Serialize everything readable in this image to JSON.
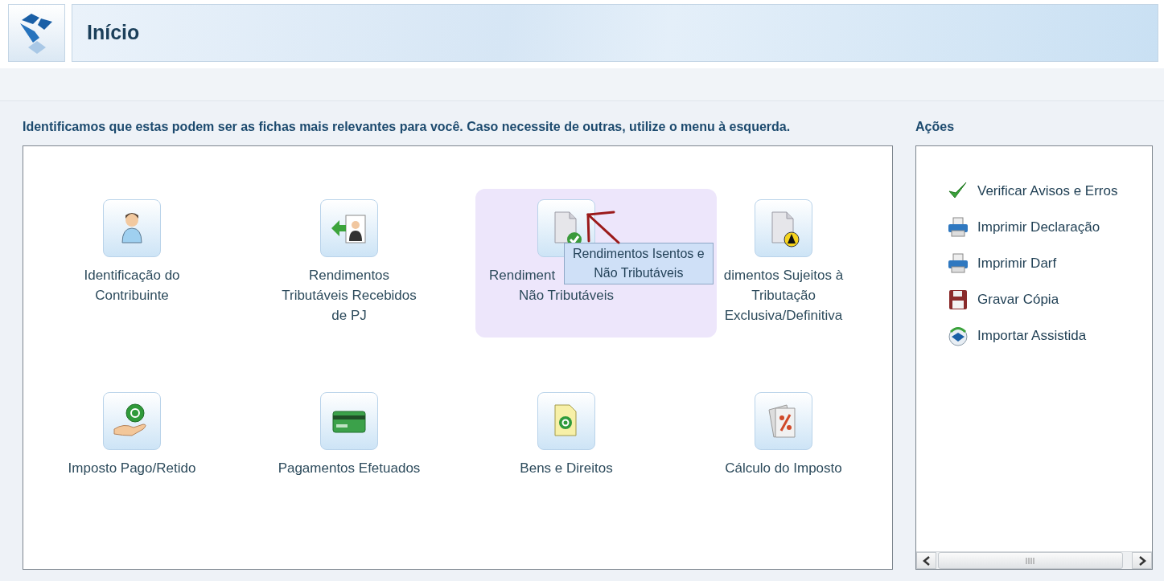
{
  "header": {
    "title": "Início"
  },
  "intro": "Identificamos que estas podem ser as fichas mais relevantes para você. Caso necessite de outras, utilize o menu à esquerda.",
  "tiles": [
    {
      "label_lines": [
        "Identificação do",
        "Contribuinte"
      ],
      "selected": false
    },
    {
      "label_lines": [
        "Rendimentos",
        "Tributáveis Recebidos",
        "de PJ"
      ],
      "selected": false
    },
    {
      "label_lines": [
        "Rendiment",
        "Não Tributáveis"
      ],
      "selected": true
    },
    {
      "label_lines": [
        "dimentos Sujeitos à",
        "Tributação",
        "Exclusiva/Definitiva"
      ],
      "selected": false
    },
    {
      "label_lines": [
        "Imposto Pago/Retido"
      ],
      "selected": false
    },
    {
      "label_lines": [
        "Pagamentos Efetuados"
      ],
      "selected": false
    },
    {
      "label_lines": [
        "Bens e Direitos"
      ],
      "selected": false
    },
    {
      "label_lines": [
        "Cálculo do Imposto"
      ],
      "selected": false
    }
  ],
  "tooltip": {
    "lines": [
      "Rendimentos Isentos e",
      "Não Tributáveis"
    ]
  },
  "actions": {
    "title": "Ações",
    "items": [
      {
        "label": "Verificar Avisos e Erros"
      },
      {
        "label": "Imprimir Declaração"
      },
      {
        "label": "Imprimir Darf"
      },
      {
        "label": "Gravar Cópia"
      },
      {
        "label": "Importar Assistida"
      }
    ]
  }
}
